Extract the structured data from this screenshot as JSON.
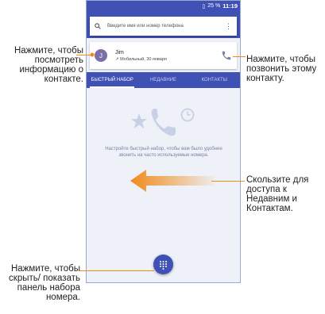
{
  "status": {
    "battery": "25 %",
    "time": "11:19"
  },
  "search": {
    "placeholder": "Введите имя или номер телефона"
  },
  "contact": {
    "initial": "J",
    "name": "Jim",
    "detail": "Мобильный, 30 января"
  },
  "tabs": [
    {
      "label": "БЫСТРЫЙ НАБОР"
    },
    {
      "label": "НЕДАВНИЕ"
    },
    {
      "label": "КОНТАКТЫ"
    }
  ],
  "empty": {
    "text": "Настройте быстрый набор, чтобы вам было удобнее звонить на часто используемые номера."
  },
  "callouts": {
    "view_contact": "Нажмите, чтобы посмотреть информацию о контакте.",
    "call_contact": "Нажмите, чтобы позвонить этому контакту.",
    "swipe": "Скользите для доступа к Недавним и Контактам.",
    "dialpad": "Нажмите, чтобы скрыть/ показать панель набора номера."
  },
  "colors": {
    "primary": "#3f51b5",
    "accent": "#f08a1a"
  }
}
